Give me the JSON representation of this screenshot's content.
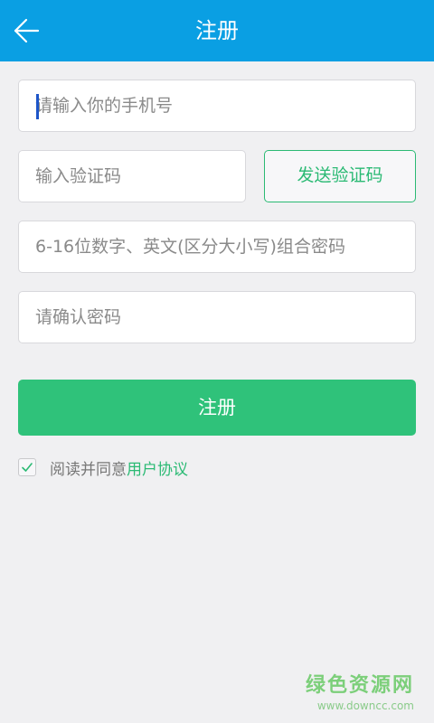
{
  "header": {
    "title": "注册",
    "back_icon": "arrow-left-icon"
  },
  "form": {
    "phone_placeholder": "请输入你的手机号",
    "code_placeholder": "输入验证码",
    "send_code_label": "发送验证码",
    "password_placeholder": "6-16位数字、英文(区分大小写)组合密码",
    "confirm_placeholder": "请确认密码",
    "register_label": "注册",
    "agree_text": "阅读并同意",
    "agreement_link": "用户协议",
    "agree_checked": true
  },
  "watermark": {
    "title": "绿色资源网",
    "url": "www.downcc.com"
  },
  "colors": {
    "header_bg": "#0a9fe3",
    "accent_green": "#2fc27a",
    "page_bg": "#f0f0f2"
  }
}
